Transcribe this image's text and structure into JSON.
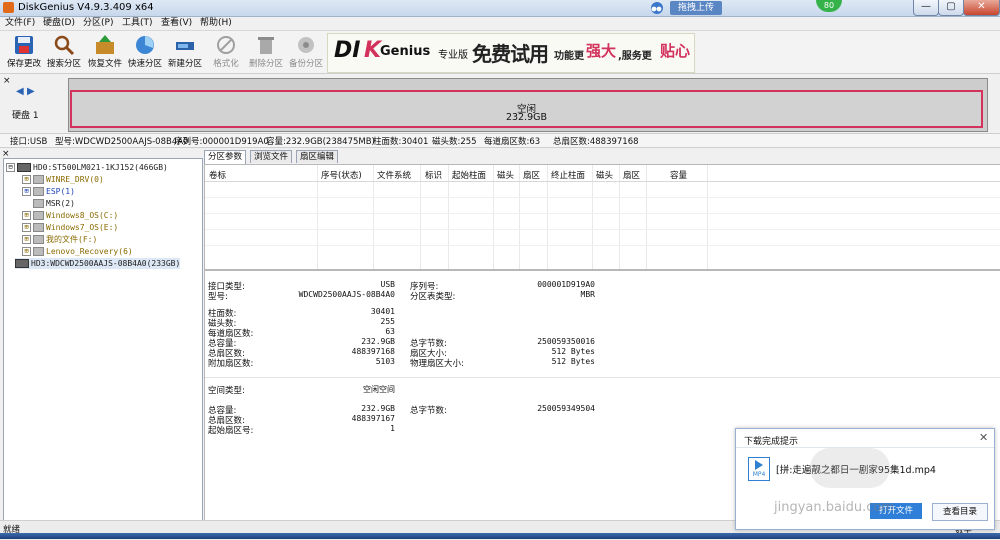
{
  "window": {
    "title": "DiskGenius V4.9.3.409 x64",
    "upload_label": "拖拽上传",
    "score": "80",
    "controls": [
      "—",
      "▢",
      "✕"
    ]
  },
  "menubar": [
    "文件(F)",
    "硬盘(D)",
    "分区(P)",
    "工具(T)",
    "查看(V)",
    "帮助(H)"
  ],
  "toolbar": [
    {
      "label": "保存更改",
      "icon": "save-icon",
      "enabled": true
    },
    {
      "label": "搜索分区",
      "icon": "magnifier-icon",
      "enabled": true
    },
    {
      "label": "恢复文件",
      "icon": "recover-files-icon",
      "enabled": true
    },
    {
      "label": "快速分区",
      "icon": "quick-partition-icon",
      "enabled": true
    },
    {
      "label": "新建分区",
      "icon": "new-partition-icon",
      "enabled": true
    },
    {
      "label": "格式化",
      "icon": "format-icon",
      "enabled": false
    },
    {
      "label": "删除分区",
      "icon": "trash-icon",
      "enabled": false
    },
    {
      "label": "备份分区",
      "icon": "backup-icon",
      "enabled": false
    }
  ],
  "ad_banner": {
    "brand": "DI",
    "brand_accent": "K",
    "brand_rest": "Genius",
    "edition": "专业版",
    "slogan_free": "免费试用",
    "slogan_rest_1": "功能更",
    "slogan_big_1": "强大",
    "slogan_rest_2": ",服务更",
    "slogan_big_2": "贴心"
  },
  "disk_map": {
    "disk_label": "硬盘 1",
    "free_label": "空闲",
    "free_size": "232.9GB"
  },
  "disk_info_line": {
    "interface": "接口:USB",
    "model": "型号:WDCWD2500AAJS-08B4A0",
    "serial": "序列号:000001D919A0",
    "capacity": "容量:232.9GB(238475MB)",
    "cylinders": "柱面数:30401",
    "heads": "磁头数:255",
    "sectors_per_track": "每道扇区数:63",
    "total_sectors": "总扇区数:488397168"
  },
  "tree": [
    {
      "label": "HD0:ST500LM021-1KJ152(466GB)",
      "level": 0,
      "kind": "disk",
      "expander": "⊟",
      "color": "dark"
    },
    {
      "label": "WINRE_DRV(0)",
      "level": 1,
      "kind": "part",
      "expander": "⊞",
      "color": "olive"
    },
    {
      "label": "ESP(1)",
      "level": 1,
      "kind": "part",
      "expander": "⊞",
      "color": "blue"
    },
    {
      "label": "MSR(2)",
      "level": 1,
      "kind": "part",
      "expander": "",
      "color": "dark"
    },
    {
      "label": "Windows8_OS(C:)",
      "level": 1,
      "kind": "part",
      "expander": "⊞",
      "color": "olive"
    },
    {
      "label": "Windows7_OS(E:)",
      "level": 1,
      "kind": "part",
      "expander": "⊞",
      "color": "olive"
    },
    {
      "label": "我的文件(F:)",
      "level": 1,
      "kind": "part",
      "expander": "⊞",
      "color": "olive"
    },
    {
      "label": "Lenovo_Recovery(6)",
      "level": 1,
      "kind": "part",
      "expander": "⊞",
      "color": "olive"
    },
    {
      "label": "HD3:WDCWD2500AAJS-08B4A0(233GB)",
      "level": 0,
      "kind": "disk",
      "expander": "",
      "color": "dark",
      "selected": true
    }
  ],
  "tabs": [
    "分区参数",
    "浏览文件",
    "扇区编辑"
  ],
  "partition_table": {
    "columns": [
      "卷标",
      "序号(状态)",
      "文件系统",
      "标识",
      "起始柱面",
      "磁头",
      "扇区",
      "终止柱面",
      "磁头",
      "扇区",
      "容量"
    ]
  },
  "details": {
    "interface_type_label": "接口类型:",
    "interface_type": "USB",
    "model_label": "型号:",
    "model": "WDCWD2500AAJS-08B4A0",
    "serial_label": "序列号:",
    "serial": "000001D919A0",
    "pt_type_label": "分区表类型:",
    "pt_type": "MBR",
    "cyl_label": "柱面数:",
    "cyl": "30401",
    "heads_label": "磁头数:",
    "heads": "255",
    "spt_label": "每道扇区数:",
    "spt": "63",
    "cap_label": "总容量:",
    "cap": "232.9GB",
    "bytes_label": "总字节数:",
    "bytes": "250059350016",
    "sectors_label": "总扇区数:",
    "sectors": "488397168",
    "sector_size_label": "扇区大小:",
    "sector_size": "512 Bytes",
    "extra_label": "附加扇区数:",
    "extra": "5103",
    "phys_label": "物理扇区大小:",
    "phys": "512 Bytes",
    "space_type_label": "空间类型:",
    "space_type": "空闲空间",
    "space_cap_label": "总容量:",
    "space_cap": "232.9GB",
    "space_bytes_label": "总字节数:",
    "space_bytes": "250059349504",
    "space_sectors_label": "总扇区数:",
    "space_sectors": "488397167",
    "start_sector_label": "起始扇区号:",
    "start_sector": "1"
  },
  "status": {
    "text": "就绪",
    "num": "数字"
  },
  "download_popup": {
    "title": "下载完成提示",
    "file_badge": "MP4",
    "file_name": "[拼:走遍靓之都日一剧家95集1d.mp4",
    "open_label": "打开文件",
    "view_label": "查看目录"
  },
  "watermark": "jingyan.baidu.com",
  "colors": {
    "accent": "#d2325b",
    "tree_olive": "#8a6a00",
    "tree_blue": "#1c43b8",
    "popup_blue": "#2f7fd8"
  }
}
